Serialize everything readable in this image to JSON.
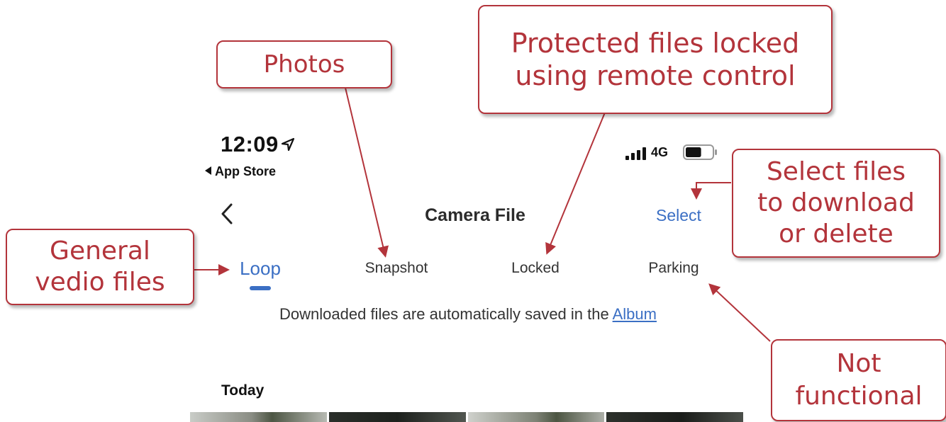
{
  "status_bar": {
    "time": "12:09",
    "back_app": "App Store",
    "network": "4G",
    "battery_level": 0.6
  },
  "nav": {
    "title": "Camera File",
    "select_label": "Select"
  },
  "tabs": [
    {
      "label": "Loop",
      "active": true
    },
    {
      "label": "Snapshot",
      "active": false
    },
    {
      "label": "Locked",
      "active": false
    },
    {
      "label": "Parking",
      "active": false
    }
  ],
  "notice": {
    "text_before": "Downloaded files are automatically saved in the ",
    "link": "Album"
  },
  "section_header": "Today",
  "annotations": {
    "photos": "Photos",
    "protected_line1": "Protected files locked",
    "protected_line2": "using remote control",
    "select_line1": "Select files",
    "select_line2": "to download",
    "select_line3": "or delete",
    "general_line1": "General",
    "general_line2": "vedio files",
    "notfunc_line1": "Not",
    "notfunc_line2": "functional"
  },
  "colors": {
    "accent": "#3b6fc4",
    "annotation": "#b3343b"
  }
}
